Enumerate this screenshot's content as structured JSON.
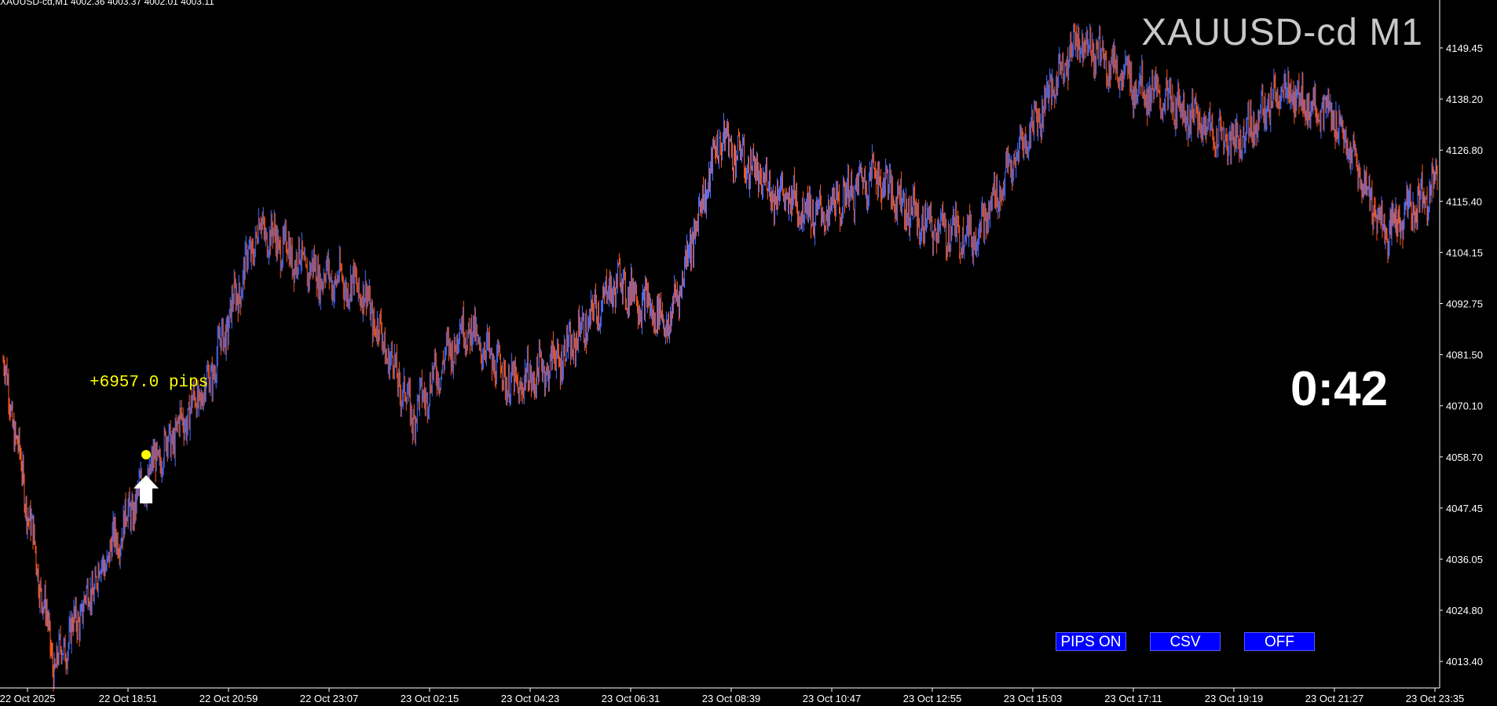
{
  "window": {
    "ohlc_header": "XAUUSD-cd,M1  4002.36 4003.37 4002.01 4003.11",
    "symbol_title": "XAUUSD-cd M1",
    "countdown": "0:42",
    "pips_label": "+6957.0 pips"
  },
  "buttons": [
    {
      "label": "PIPS ON"
    },
    {
      "label": "CSV"
    },
    {
      "label": "OFF"
    }
  ],
  "colors": {
    "background": "#000000",
    "up_bar": "#4f6fff",
    "down_bar": "#ff5a1f",
    "axis": "#ffffff",
    "signal_dot": "#ffff00",
    "signal_arrow": "#ffffff",
    "button_bg": "#0000ff"
  },
  "icons": {
    "entry_arrow": "up-arrow-icon",
    "entry_dot": "signal-dot-icon"
  },
  "chart_data": {
    "type": "line",
    "symbol": "XAUUSD-cd",
    "timeframe": "M1",
    "y_ticks": [
      "4149.45",
      "4138.20",
      "4126.80",
      "4115.40",
      "4104.15",
      "4092.75",
      "4081.50",
      "4070.10",
      "4058.70",
      "4047.45",
      "4036.05",
      "4024.80",
      "4013.40"
    ],
    "x_ticks": [
      "22 Oct 2025",
      "22 Oct 18:51",
      "22 Oct 20:59",
      "22 Oct 23:07",
      "23 Oct 02:15",
      "23 Oct 04:23",
      "23 Oct 06:31",
      "23 Oct 08:39",
      "23 Oct 10:47",
      "23 Oct 12:55",
      "23 Oct 15:03",
      "23 Oct 17:11",
      "23 Oct 19:19",
      "23 Oct 21:27",
      "23 Oct 23:35"
    ],
    "ylim": [
      4008.0,
      4160.5
    ],
    "x": [
      "22 Oct 2025",
      "22 Oct 17:40",
      "22 Oct 18:51",
      "22 Oct 19:30",
      "22 Oct 20:59",
      "22 Oct 21:40",
      "22 Oct 23:07",
      "23 Oct 00:30",
      "23 Oct 02:15",
      "23 Oct 03:00",
      "23 Oct 04:23",
      "23 Oct 05:30",
      "23 Oct 06:31",
      "23 Oct 07:30",
      "23 Oct 08:39",
      "23 Oct 09:40",
      "23 Oct 10:47",
      "23 Oct 11:50",
      "23 Oct 12:55",
      "23 Oct 14:00",
      "23 Oct 15:03",
      "23 Oct 16:10",
      "23 Oct 17:11",
      "23 Oct 18:15",
      "23 Oct 19:19",
      "23 Oct 20:20",
      "23 Oct 21:27",
      "23 Oct 22:30",
      "23 Oct 23:35"
    ],
    "series": [
      {
        "values": [
          4080,
          4012,
          4036,
          4058,
          4075,
          4110,
          4100,
          4096,
          4068,
          4088,
          4074,
          4082,
          4098,
          4088,
          4130,
          4118,
          4112,
          4122,
          4110,
          4108,
          4130,
          4152,
          4142,
          4136,
          4128,
          4140,
          4134,
          4108,
          4120
        ]
      }
    ]
  }
}
